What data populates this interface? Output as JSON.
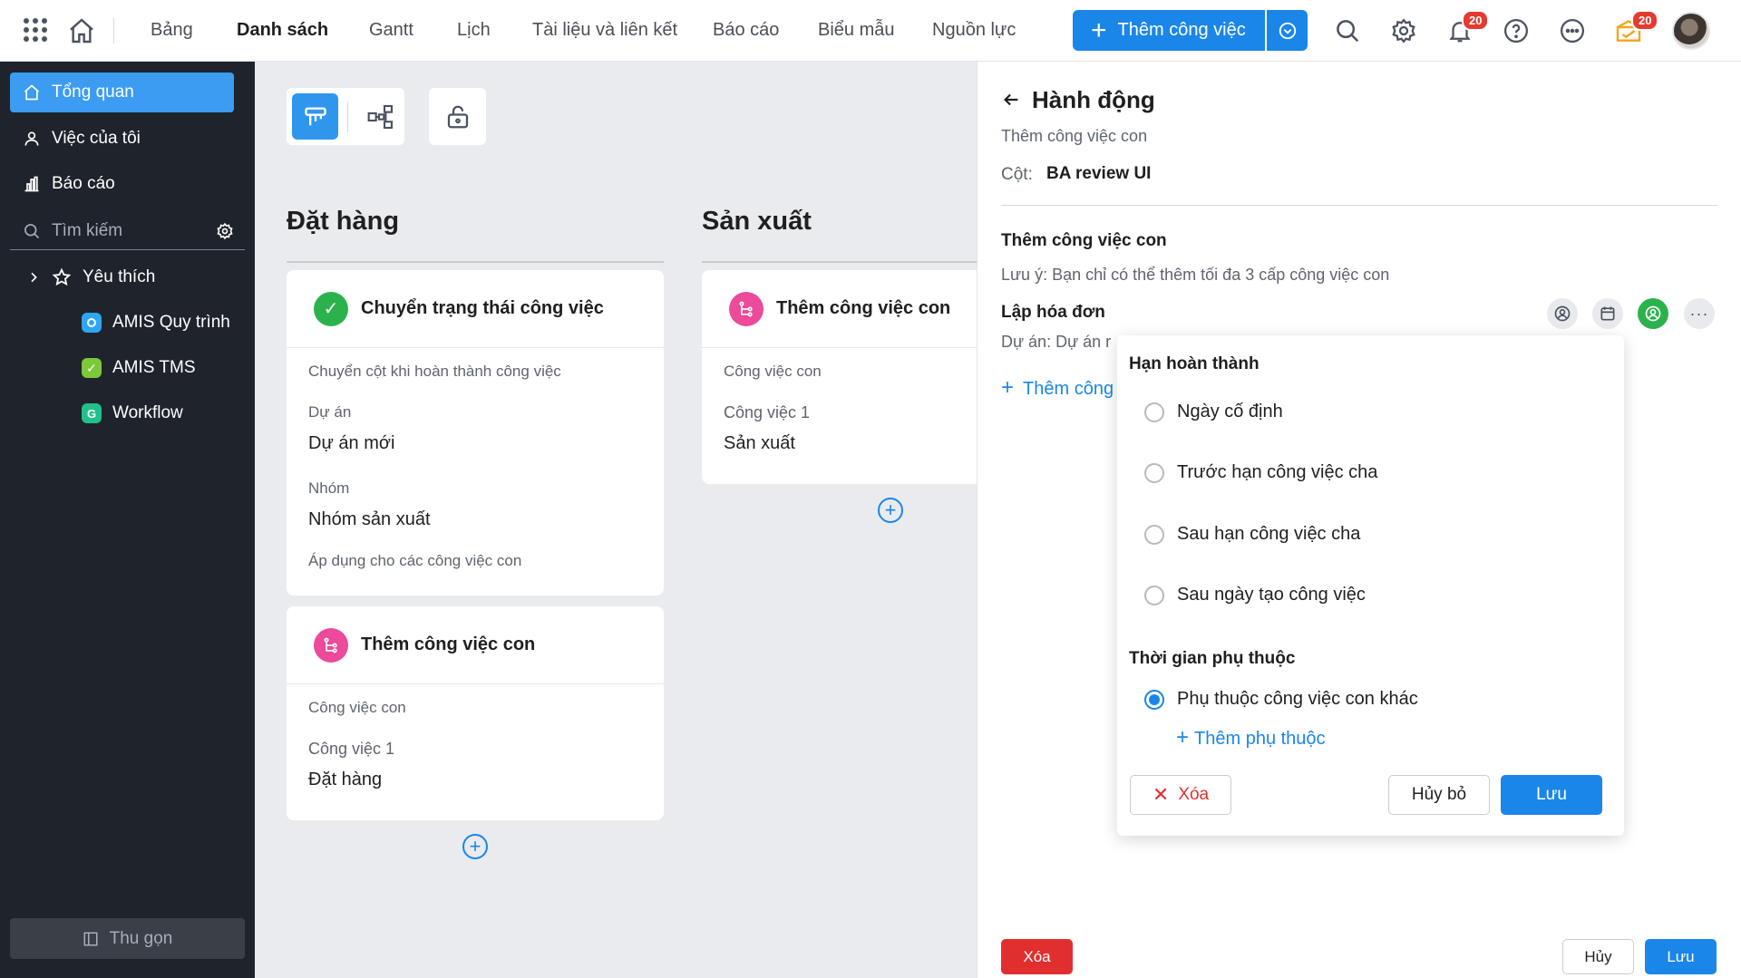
{
  "nav": {
    "tabs": [
      "Bảng",
      "Danh sách",
      "Gantt",
      "Lịch",
      "Tài liệu và liên kết",
      "Báo cáo",
      "Biểu mẫu",
      "Nguồn lực"
    ],
    "active_tab": "Danh sách",
    "add_task_label": "Thêm công việc",
    "notification_count": "20",
    "activity_count": "20"
  },
  "sidebar": {
    "overview": "Tổng quan",
    "my_tasks": "Việc của tôi",
    "reports": "Báo cáo",
    "search_placeholder": "Tìm kiếm",
    "favorites": "Yêu thích",
    "apps": [
      "AMIS Quy trình",
      "AMIS TMS",
      "Workflow"
    ],
    "collapse": "Thu gọn"
  },
  "board": {
    "columns": [
      {
        "title": "Đặt hàng",
        "cards": [
          {
            "title": "Chuyển trạng thái công việc",
            "subtitle": "Chuyển cột khi hoàn thành công việc",
            "project_label": "Dự án",
            "project_value": "Dự án mới",
            "group_label": "Nhóm",
            "group_value": "Nhóm sản xuất",
            "note": "Áp dụng cho các công việc con"
          },
          {
            "title": "Thêm công việc con",
            "subtitle": "Công việc con",
            "task_label": "Công việc 1",
            "task_value": "Đặt hàng"
          }
        ]
      },
      {
        "title": "Sản xuất",
        "cards": [
          {
            "title": "Thêm công việc con",
            "subtitle": "Công việc con",
            "task_label": "Công việc 1",
            "task_value": "Sản xuất"
          }
        ]
      }
    ]
  },
  "panel": {
    "title": "Hành động",
    "subtitle": "Thêm công việc con",
    "column_label": "Cột:",
    "column_value": "BA review UI",
    "section_title": "Thêm công việc con",
    "note": "Lưu ý: Bạn chỉ có thể thêm tối đa 3 cấp công việc con",
    "task_name": "Lập hóa đơn",
    "project_line": "Dự án: Dự án r",
    "add_link": "Thêm công",
    "delete": "Xóa",
    "cancel": "Hủy",
    "save": "Lưu"
  },
  "popup": {
    "deadline_title": "Hạn hoàn thành",
    "options": [
      "Ngày cố định",
      "Trước hạn công việc cha",
      "Sau hạn công việc cha",
      "Sau ngày tạo công việc"
    ],
    "dependency_title": "Thời gian phụ thuộc",
    "dependency_option": "Phụ thuộc công việc con khác",
    "add_dependency": "Thêm phụ thuộc",
    "delete": "Xóa",
    "cancel": "Hủy bỏ",
    "save": "Lưu"
  },
  "colors": {
    "primary": "#1a86e8",
    "sidebar_bg": "#1e232c",
    "danger": "#e12f2f",
    "success": "#2bb24c",
    "pink": "#ec4a9a"
  }
}
